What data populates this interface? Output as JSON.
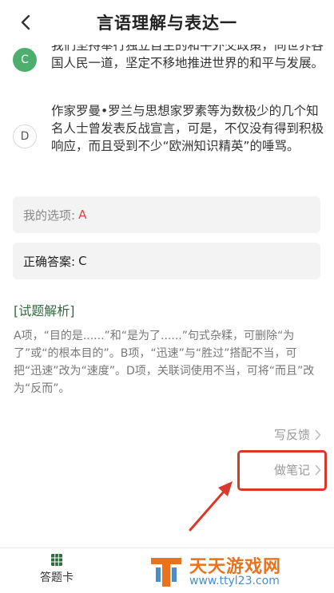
{
  "header": {
    "title": "言语理解与表达一"
  },
  "options": [
    {
      "letter": "C",
      "state": "correct",
      "text": "我们坚持奉行独立自主的和平外交政策，同世界各国人民一道，坚定不移地推进世界的和平与发展。"
    },
    {
      "letter": "D",
      "state": "normal",
      "text": "作家罗曼•罗兰与思想家罗素等为数极少的几个知名人士曾发表反战宣言，可是，不仅没有得到积极响应，而且受到不少“欧洲知识精英”的唾骂。"
    }
  ],
  "my_choice": {
    "label": "我的选项:",
    "value": "A"
  },
  "correct_answer": {
    "label": "正确答案:",
    "value": "C"
  },
  "analysis": {
    "title": "[试题解析]",
    "text": "A项，“目的是......”和“是为了......”句式杂糅，可删除“为了”或“的根本目的”。B项，“迅速”与“胜过”搭配不当，可把“迅速”改为“速度”。D项，关联词使用不当，可将“而且”改为“反而”。"
  },
  "links": {
    "feedback": "写反馈",
    "note": "做笔记"
  },
  "bottom": {
    "answer_card": "答题卡"
  },
  "watermark": {
    "name": "天天游戏网",
    "url": "www.ttyl23.com"
  },
  "colors": {
    "correct_green": "#4caf6e",
    "wrong_red": "#e04848",
    "highlight_red": "#d8392b",
    "analysis_green": "#2f6b3d"
  }
}
